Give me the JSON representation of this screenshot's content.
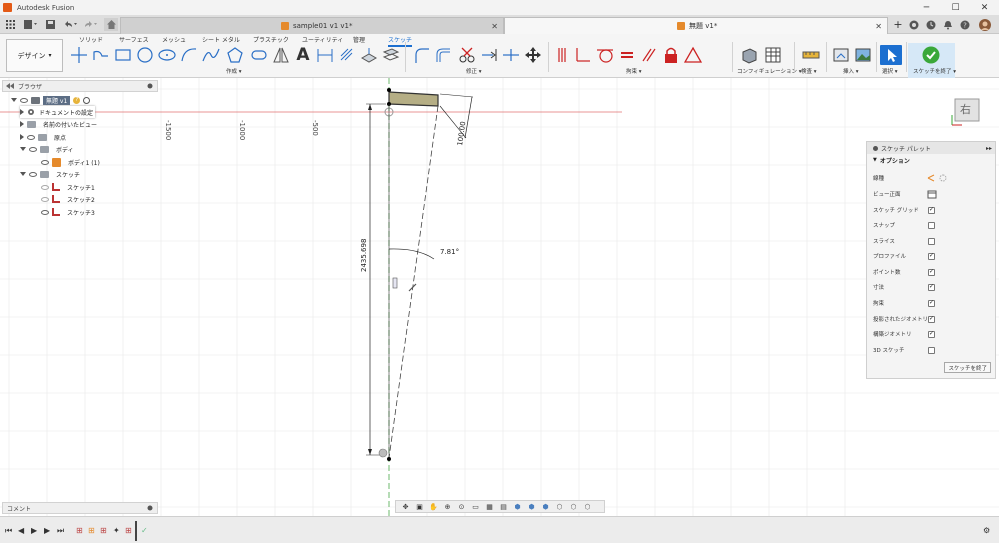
{
  "window": {
    "title": "Autodesk Fusion",
    "minimize": "─",
    "maximize": "☐",
    "close": "✕"
  },
  "tabs": [
    {
      "label": "sample01 v1 v1*",
      "active": false
    },
    {
      "label": "無題 v1*",
      "active": true
    }
  ],
  "tab_close": "✕",
  "tabbar_add": "+",
  "toolbar": {
    "workspace_label": "デザイン",
    "workspace_tabs": [
      "ソリッド",
      "サーフェス",
      "メッシュ",
      "シート メタル",
      "プラスチック",
      "ユーティリティ",
      "管理",
      "スケッチ"
    ],
    "active_workspace_tab": "スケッチ",
    "groups": {
      "create": "作成",
      "modify": "修正",
      "constraints": "拘束",
      "configuration": "コンフィギュレーション",
      "inspect": "検査",
      "insert": "挿入",
      "select": "選択",
      "finish": "スケッチを終了"
    }
  },
  "browser": {
    "title": "ブラウザ",
    "items": [
      {
        "label": "無題 v1",
        "level": 0
      },
      {
        "label": "ドキュメントの設定",
        "level": 1
      },
      {
        "label": "名前の付いたビュー",
        "level": 1
      },
      {
        "label": "原点",
        "level": 1
      },
      {
        "label": "ボディ",
        "level": 1
      },
      {
        "label": "ボディ1 (1)",
        "level": 2
      },
      {
        "label": "スケッチ",
        "level": 1
      },
      {
        "label": "スケッチ1",
        "level": 2
      },
      {
        "label": "スケッチ2",
        "level": 2
      },
      {
        "label": "スケッチ3",
        "level": 2
      }
    ]
  },
  "comment_panel": {
    "title": "コメント"
  },
  "canvas": {
    "ruler_labels": [
      "-1500",
      "-1000",
      "-500"
    ],
    "dimensions": {
      "vertical_length": "2435.698",
      "angle": "7.81°",
      "thickness": "100.00"
    },
    "viewcube_face": "右"
  },
  "sketch_palette": {
    "title": "スケッチ パレット",
    "options_title": "オプション",
    "options": [
      {
        "label": "線種",
        "type": "linetype",
        "checked": false
      },
      {
        "label": "ビュー正面",
        "type": "button",
        "checked": false
      },
      {
        "label": "スケッチ グリッド",
        "type": "checkbox",
        "checked": true
      },
      {
        "label": "スナップ",
        "type": "checkbox",
        "checked": false
      },
      {
        "label": "スライス",
        "type": "checkbox",
        "checked": false
      },
      {
        "label": "プロファイル",
        "type": "checkbox",
        "checked": true
      },
      {
        "label": "ポイント数",
        "type": "checkbox",
        "checked": true
      },
      {
        "label": "寸法",
        "type": "checkbox",
        "checked": true
      },
      {
        "label": "拘束",
        "type": "checkbox",
        "checked": true
      },
      {
        "label": "投影されたジオメトリ",
        "type": "checkbox",
        "checked": true
      },
      {
        "label": "構築ジオメトリ",
        "type": "checkbox",
        "checked": true
      },
      {
        "label": "3D スケッチ",
        "type": "checkbox",
        "checked": false
      }
    ],
    "finish_button": "スケッチを終了"
  },
  "colors": {
    "accent": "#1c6fd0",
    "finish_green": "#3aa83a",
    "constraint_red": "#d43a3a",
    "grid_line": "#e6e6e6",
    "axis_red": "#e07070",
    "axis_green": "#4aa84a",
    "body_fill": "#b5ae85"
  }
}
